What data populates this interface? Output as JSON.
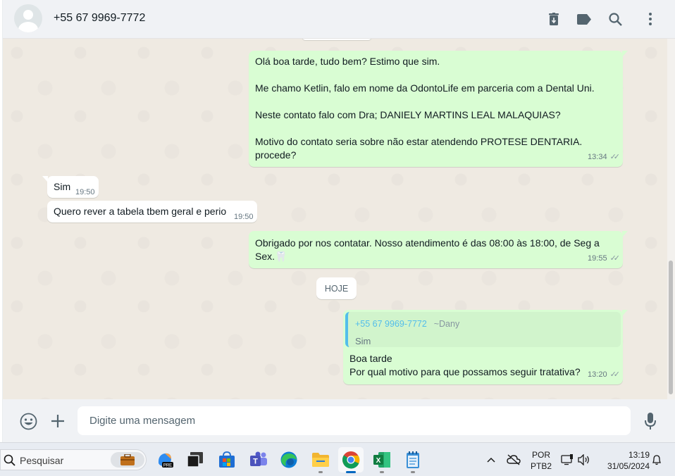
{
  "header": {
    "contact_name": "+55 67 9969-7772"
  },
  "messages": [
    {
      "direction": "out",
      "text": "Olá boa tarde, tudo bem? Estimo que sim.\n\nMe chamo Ketlin, falo em nome da OdontoLife em parceria com a Dental Uni.\n\nNeste contato falo com Dra; DANIELY MARTINS LEAL MALAQUIAS?\n\nMotivo do contato seria sobre não estar atendendo PROTESE DENTARIA. procede?",
      "time": "13:34",
      "status": "read"
    },
    {
      "direction": "in",
      "text": "Sim",
      "time": "19:50"
    },
    {
      "direction": "in",
      "text": "Quero rever a tabela tbem geral e perio",
      "time": "19:50"
    },
    {
      "direction": "out",
      "text": "Obrigado por nos contatar. Nosso atendimento é das 08:00 às 18:00, de Seg a Sex.🦷",
      "time": "19:55",
      "status": "read"
    },
    {
      "direction": "out",
      "quote": {
        "name": "+55 67 9969-7772",
        "alias": "~Dany",
        "text": "Sim"
      },
      "text": "Boa tarde\nPor qual motivo para que possamos seguir tratativa?",
      "time": "13:20",
      "status": "read"
    }
  ],
  "date_separator": "HOJE",
  "composer": {
    "placeholder": "Digite uma mensagem"
  },
  "taskbar": {
    "search_label": "Pesquisar",
    "apps": [
      "copilot-icon",
      "task-view-icon",
      "store-icon",
      "teams-icon",
      "edge-icon",
      "file-explorer-icon",
      "chrome-icon",
      "excel-icon",
      "notepad-icon"
    ],
    "active_app": "chrome-icon",
    "language_line1": "POR",
    "language_line2": "PTB2",
    "time": "13:19",
    "date": "31/05/2024"
  },
  "colors": {
    "outgoing_bubble": "#d9fdd3",
    "incoming_bubble": "#ffffff",
    "chat_background": "#efeae2",
    "quote_accent": "#53bdeb",
    "header_background": "#f0f2f5"
  }
}
